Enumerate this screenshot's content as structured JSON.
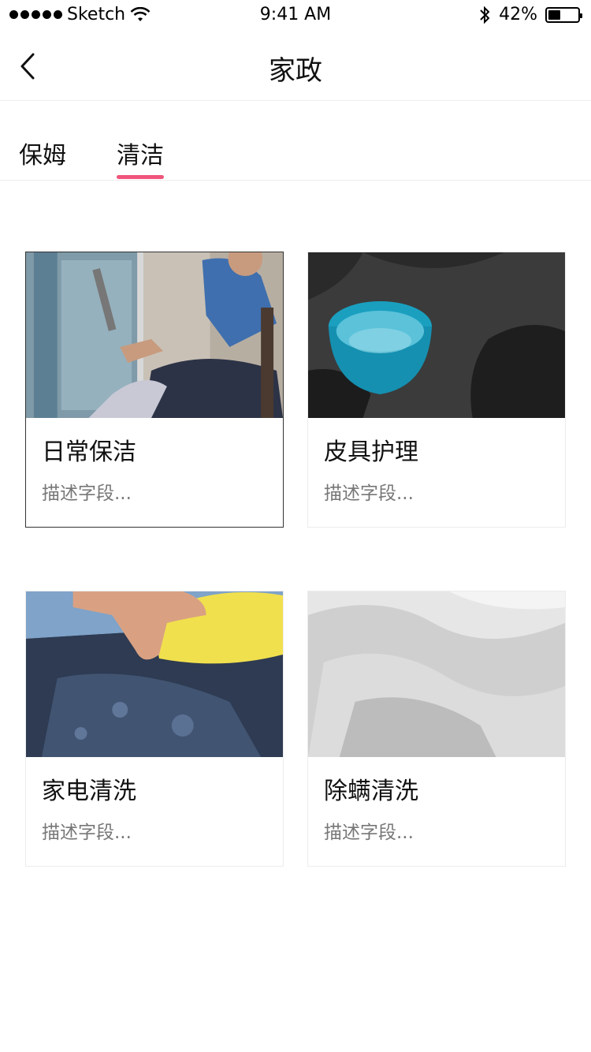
{
  "status_bar": {
    "carrier": "Sketch",
    "time": "9:41 AM",
    "battery_text": "42%",
    "battery_level": 0.42
  },
  "nav": {
    "title": "家政"
  },
  "tabs": [
    {
      "label": "保姆",
      "active": false
    },
    {
      "label": "清洁",
      "active": true
    }
  ],
  "accent_color": "#f0557a",
  "cards": [
    {
      "title": "日常保洁",
      "desc": "描述字段...",
      "image": "window-cleaning-photo",
      "selected": true
    },
    {
      "title": "皮具护理",
      "desc": "描述字段...",
      "image": "leather-sofa-bowl-photo",
      "selected": false
    },
    {
      "title": "家电清洗",
      "desc": "描述字段...",
      "image": "sponge-wiping-photo",
      "selected": false
    },
    {
      "title": "除螨清洗",
      "desc": "描述字段...",
      "image": "white-bedding-photo",
      "selected": false
    }
  ]
}
